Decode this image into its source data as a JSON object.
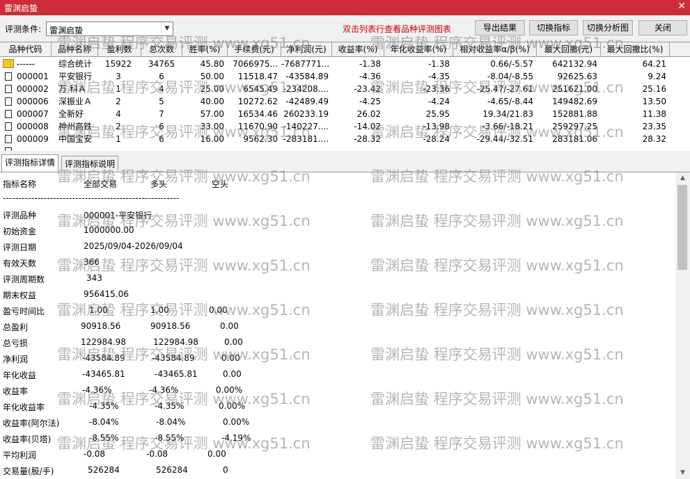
{
  "window": {
    "title": "雷渊启蛰"
  },
  "toolbar": {
    "condition_label": "评测条件:",
    "condition_value": "雷渊启蛰",
    "hint": "双击列表行查看品种评测图表",
    "export_label": "导出结果",
    "switch_index_label": "切换指标",
    "switch_chart_label": "切换分析图",
    "close_label": "关闭"
  },
  "grid": {
    "headers": [
      "品种代码",
      "品种名称",
      "盈利数",
      "总次数",
      "胜率(%)",
      "手续费(元)",
      "净利润(元)",
      "收益率(%)",
      "年化收益率(%)",
      "相对收益率α/β(%)",
      "最大回撤(元)",
      "最大回撤比(%)"
    ],
    "rows": [
      [
        "------",
        "综合统计",
        "15922",
        "34765",
        "45.80",
        "7066975...",
        "-7687771...",
        "-1.38",
        "-1.38",
        "0.66/-5.57",
        "642132.94",
        "64.21"
      ],
      [
        "000001",
        "平安银行",
        "3",
        "6",
        "50.00",
        "11518.47",
        "-43584.89",
        "-4.36",
        "-4.35",
        "-8.04/-8.55",
        "92625.63",
        "9.24"
      ],
      [
        "000002",
        "万 科Ａ",
        "1",
        "4",
        "25.00",
        "6545.49",
        "-234208....",
        "-23.42",
        "-23.36",
        "-25.47/-27.61",
        "251621.00",
        "25.16"
      ],
      [
        "000006",
        "深振业Ａ",
        "2",
        "5",
        "40.00",
        "10272.62",
        "-42489.49",
        "-4.25",
        "-4.24",
        "-4.65/-8.44",
        "149482.69",
        "13.50"
      ],
      [
        "000007",
        "全新好",
        "4",
        "7",
        "57.00",
        "16534.46",
        "260233.19",
        "26.02",
        "25.95",
        "19.34/21.83",
        "152881.88",
        "11.38"
      ],
      [
        "000008",
        "神州高铁",
        "2",
        "6",
        "33.00",
        "11670.90",
        "-140227....",
        "-14.02",
        "-13.98",
        "-3.66/-18.21",
        "259297.25",
        "23.35"
      ],
      [
        "000009",
        "中国宝安",
        "1",
        "6",
        "16.00",
        "9562.30",
        "-283181....",
        "-28.32",
        "-28.24",
        "-29.44/-32.51",
        "283181.06",
        "28.32"
      ]
    ]
  },
  "tabs": [
    "评测指标详情",
    "评测指标说明"
  ],
  "detail": {
    "col_headers": [
      "指标名称",
      "全部交易",
      "多头",
      "空头"
    ],
    "separator": "--------------------------------------------------------",
    "info": [
      {
        "label": "评测品种",
        "value": "000001-平安银行"
      },
      {
        "label": "初始资金",
        "value": "1000000.00"
      },
      {
        "label": "评测日期",
        "value": "2025/09/04-2026/09/04"
      },
      {
        "label": "有效天数",
        "value": "366"
      },
      {
        "label": "评测周期数",
        "value": "343"
      },
      {
        "label": "期末权益",
        "value": "956415.06"
      }
    ],
    "metrics": [
      {
        "label": "盈亏时间比",
        "all": "1.00",
        "long": "1.00",
        "short": "0.00"
      },
      {
        "label": "总盈利",
        "all": "90918.56",
        "long": "90918.56",
        "short": "0.00"
      },
      {
        "label": "总亏损",
        "all": "122984.98",
        "long": "122984.98",
        "short": "0.00"
      },
      {
        "label": "净利润",
        "all": "-43584.89",
        "long": "-43584.89",
        "short": "0.00"
      },
      {
        "label": "年化收益",
        "all": "-43465.81",
        "long": "-43465.81",
        "short": "0.00"
      },
      {
        "label": "收益率",
        "all": "-4.36%",
        "long": "-4.36%",
        "short": "0.00%"
      },
      {
        "label": "年化收益率",
        "all": "-4.35%",
        "long": "-4.35%",
        "short": "0.00%"
      },
      {
        "label": "收益率(阿尔法)",
        "all": "-8.04%",
        "long": "-8.04%",
        "short": "0.00%"
      },
      {
        "label": "收益率(贝塔)",
        "all": "-8.55%",
        "long": "-8.55%",
        "short": "-4.19%"
      },
      {
        "label": "平均利润",
        "all": "-0.08",
        "long": "-0.08",
        "short": "0.00"
      },
      {
        "label": "交易量(股/手)",
        "all": "526284",
        "long": "526284",
        "short": "0"
      }
    ]
  },
  "watermark": "雷渊启蛰 程序交易评测 www.xg51.cn",
  "colors": {
    "titlebar": "#cc2d3a",
    "hint": "#d40000",
    "folder": "#f2c230"
  },
  "icons": {
    "summary_row": "folder-icon",
    "stock_rows": "checkbox-icon",
    "scroll_up": "up-arrow-icon",
    "scroll_down": "down-arrow-icon",
    "close": "close-icon"
  }
}
